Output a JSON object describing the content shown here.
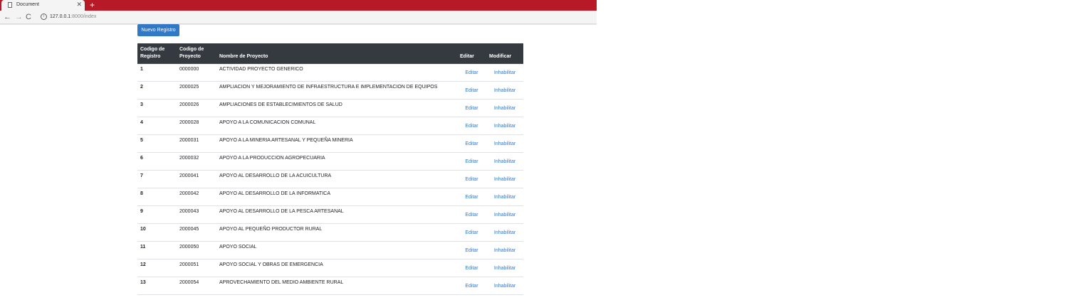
{
  "browser": {
    "tab_title": "Document",
    "tab_close": "✕",
    "new_tab": "+",
    "back": "←",
    "forward": "→",
    "reload": "C",
    "info": "i",
    "url_host": "127.0.0.1",
    "url_path": ":8000/index"
  },
  "page": {
    "new_button": "Nuevo Registro",
    "headers": {
      "registro": "Codigo de Registro",
      "proyecto": "Codigo de Proyecto",
      "nombre": "Nombre de Proyecto",
      "editar": "Editar",
      "modificar": "Modificar"
    },
    "rows": [
      {
        "id": "1",
        "codigo": "0000000",
        "nombre": "ACTIVIDAD PROYECTO GENERICO",
        "editar": "Editar",
        "modificar": "Inhabilitar"
      },
      {
        "id": "2",
        "codigo": "2000025",
        "nombre": "AMPLIACION Y MEJORAMIENTO DE INFRAESTRUCTURA E IMPLEMENTACION DE EQUIPOS",
        "editar": "Editar",
        "modificar": "Inhabilitar"
      },
      {
        "id": "3",
        "codigo": "2000026",
        "nombre": "AMPLIACIONES DE ESTABLECIMIENTOS DE SALUD",
        "editar": "Editar",
        "modificar": "Inhabilitar"
      },
      {
        "id": "4",
        "codigo": "2000028",
        "nombre": "APOYO A LA COMUNICACION COMUNAL",
        "editar": "Editar",
        "modificar": "Inhabilitar"
      },
      {
        "id": "5",
        "codigo": "2000031",
        "nombre": "APOYO A LA MINERIA ARTESANAL Y PEQUEÑA MINERIA",
        "editar": "Editar",
        "modificar": "Inhabilitar"
      },
      {
        "id": "6",
        "codigo": "2000032",
        "nombre": "APOYO A LA PRODUCCION AGROPECUARIA",
        "editar": "Editar",
        "modificar": "Inhabilitar"
      },
      {
        "id": "7",
        "codigo": "2000041",
        "nombre": "APOYO AL DESARROLLO DE LA ACUICULTURA",
        "editar": "Editar",
        "modificar": "Inhabilitar"
      },
      {
        "id": "8",
        "codigo": "2000042",
        "nombre": "APOYO AL DESARROLLO DE LA INFORMATICA",
        "editar": "Editar",
        "modificar": "Inhabilitar"
      },
      {
        "id": "9",
        "codigo": "2000043",
        "nombre": "APOYO AL DESARROLLO DE LA PESCA ARTESANAL",
        "editar": "Editar",
        "modificar": "Inhabilitar"
      },
      {
        "id": "10",
        "codigo": "2000045",
        "nombre": "APOYO AL PEQUEÑO PRODUCTOR RURAL",
        "editar": "Editar",
        "modificar": "Inhabilitar"
      },
      {
        "id": "11",
        "codigo": "2000050",
        "nombre": "APOYO SOCIAL",
        "editar": "Editar",
        "modificar": "Inhabilitar"
      },
      {
        "id": "12",
        "codigo": "2000051",
        "nombre": "APOYO SOCIAL Y OBRAS DE EMERGENCIA",
        "editar": "Editar",
        "modificar": "Inhabilitar"
      },
      {
        "id": "13",
        "codigo": "2000054",
        "nombre": "APROVECHAMIENTO DEL MEDIO AMBIENTE RURAL",
        "editar": "Editar",
        "modificar": "Inhabilitar"
      }
    ]
  },
  "colors": {
    "tabstrip": "#b71926",
    "button": "#3178c6",
    "table_header": "#343a40",
    "link": "#3a78c4"
  }
}
